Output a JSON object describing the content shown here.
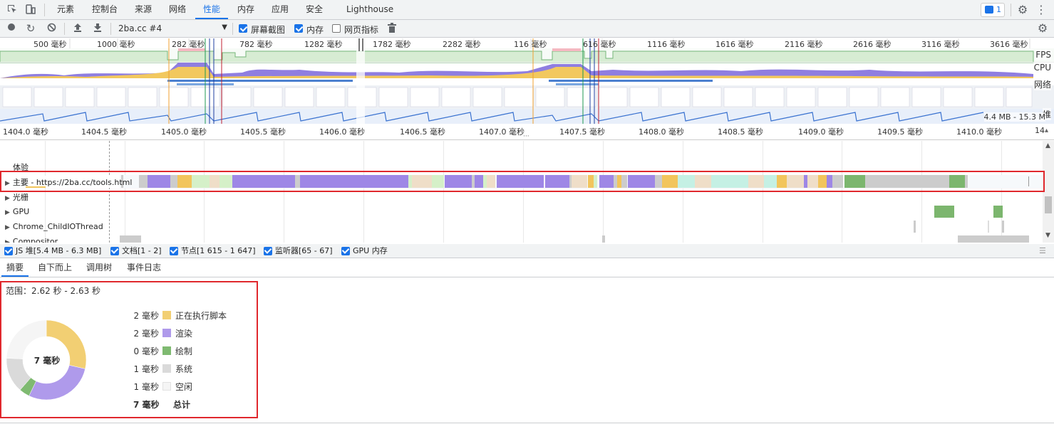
{
  "devtools_tabs": [
    "元素",
    "控制台",
    "来源",
    "网络",
    "性能",
    "内存",
    "应用",
    "安全",
    "Lighthouse"
  ],
  "active_tab": "性能",
  "issues_badge": "1",
  "toolbar": {
    "recording_select": "2ba.cc #4",
    "screenshots_label": "屏幕截图",
    "memory_label": "内存",
    "web_vitals_label": "网页指标"
  },
  "overview": {
    "ticks": [
      "500 毫秒",
      "1000 毫秒",
      "282 毫秒",
      "782 毫秒",
      "1282 毫秒",
      "1782 毫秒",
      "2282 毫秒",
      "116 毫秒",
      "616 毫秒",
      "1116 毫秒",
      "1616 毫秒",
      "2116 毫秒",
      "2616 毫秒",
      "3116 毫秒",
      "3616 毫秒"
    ],
    "lanes": {
      "fps": "FPS",
      "cpu": "CPU",
      "net": "网络",
      "heap": "堆"
    },
    "heap_range": "4.4 MB - 15.3 M"
  },
  "ruler": {
    "ticks": [
      "1404.0 毫秒",
      "1404.5 毫秒",
      "1405.0 毫秒",
      "1405.5 毫秒",
      "1406.0 毫秒",
      "1406.5 毫秒",
      "1407.0 毫秒",
      "1407.5 毫秒",
      "1408.0 毫秒",
      "1408.5 毫秒",
      "1409.0 毫秒",
      "1409.5 毫秒",
      "1410.0 毫秒",
      "14"
    ]
  },
  "tracks": {
    "experience": "体验",
    "main": "主要 - https://2ba.cc/tools.html",
    "raster": "光栅",
    "gpu": "GPU",
    "child_io": "Chrome_ChildIOThread",
    "compositor": "Compositor"
  },
  "memory_chips": [
    {
      "label": "JS 堆[5.4 MB - 6.3 MB]",
      "color": "#8ba5e0"
    },
    {
      "label": "文档[1 - 2]",
      "color": "#e08480"
    },
    {
      "label": "节点[1 615 - 1 647]",
      "color": "#8fd98b"
    },
    {
      "label": "监听器[65 - 67]",
      "color": "#e4c282"
    },
    {
      "label": "GPU 内存",
      "color": "#e07ae0"
    }
  ],
  "bottom_tabs": [
    "摘要",
    "自下而上",
    "调用树",
    "事件日志"
  ],
  "summary": {
    "range": "范围：2.62 秒 - 2.63 秒",
    "center_total": "7 毫秒",
    "rows": [
      {
        "ms": "2 毫秒",
        "name": "正在执行脚本",
        "color": "#f2cf73",
        "value": 2
      },
      {
        "ms": "2 毫秒",
        "name": "渲染",
        "color": "#af9aeb",
        "value": 2
      },
      {
        "ms": "0 毫秒",
        "name": "绘制",
        "color": "#7fba71",
        "value": 0.3
      },
      {
        "ms": "1 毫秒",
        "name": "系统",
        "color": "#dadada",
        "value": 1
      },
      {
        "ms": "1 毫秒",
        "name": "空闲",
        "color": "#f5f5f5",
        "value": 1.7
      }
    ],
    "total_ms": "7 毫秒",
    "total_label": "总计"
  }
}
